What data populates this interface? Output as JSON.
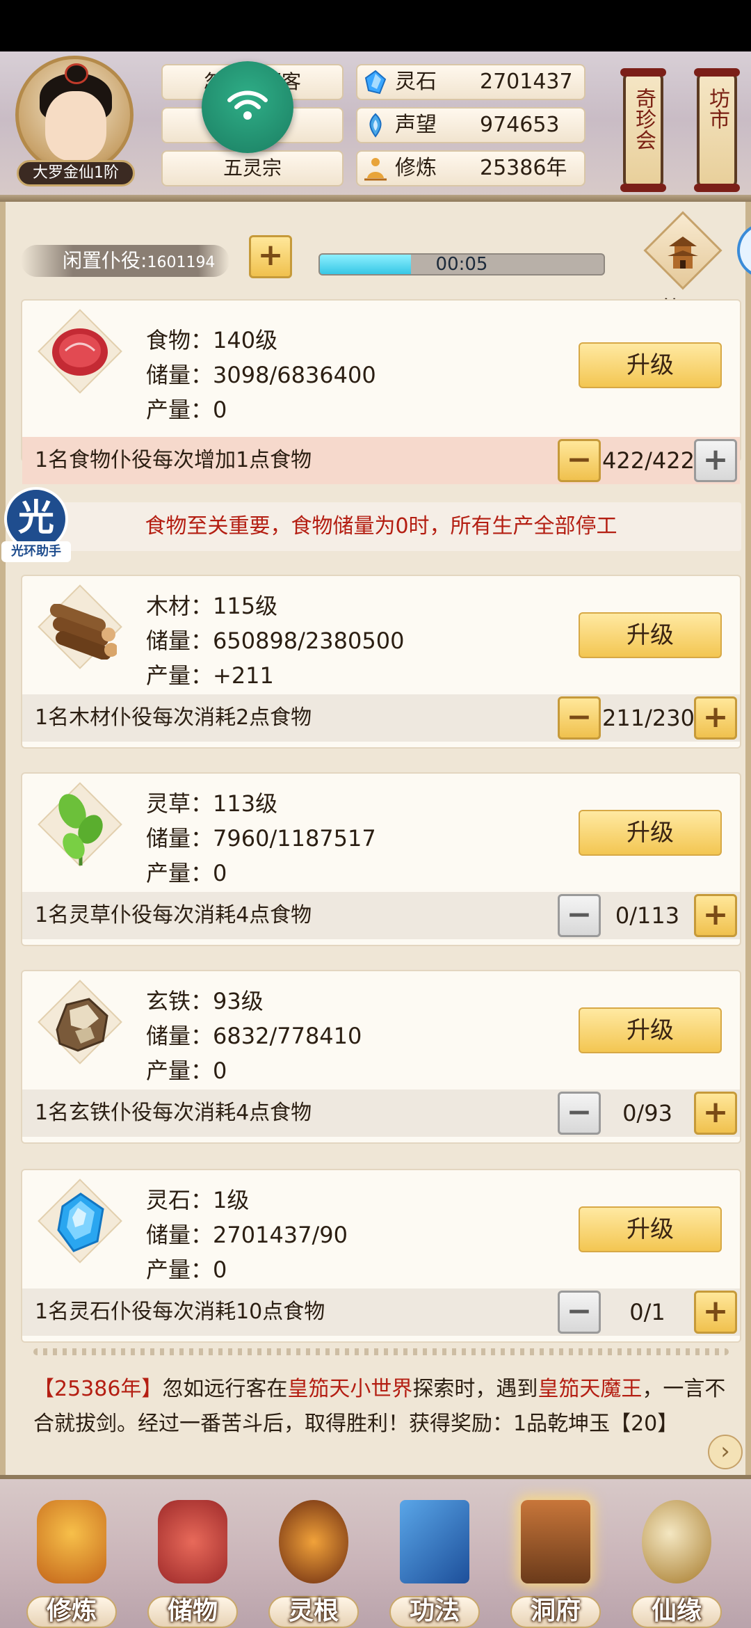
{
  "header": {
    "rank_label": "大罗金仙1阶",
    "name_line1": "忽如远行客",
    "name_line2": "",
    "sect": "五灵宗",
    "resources": [
      {
        "icon": "spirit-stone-icon",
        "label": "灵石",
        "value": "2701437"
      },
      {
        "icon": "reputation-icon",
        "label": "声望",
        "value": "974653"
      },
      {
        "icon": "cultivation-icon",
        "label": "修炼",
        "value": "25386年"
      }
    ],
    "side_buttons": [
      "奇珍会",
      "坊市"
    ]
  },
  "servants": {
    "label": "闲置仆役",
    "count": "1601194",
    "timer": "00:05",
    "timer_progress": 0.32
  },
  "xianju_label": "仙居",
  "cards": [
    {
      "name": "食物：140级",
      "storage": "储量：3098/6836400",
      "output": "产量：0",
      "upgrade": "升级",
      "desc": "1名食物仆役每次增加1点食物",
      "count": "422/422"
    },
    {
      "name": "木材：115级",
      "storage": "储量：650898/2380500",
      "output": "产量：+211",
      "upgrade": "升级",
      "desc": "1名木材仆役每次消耗2点食物",
      "count": "211/230"
    },
    {
      "name": "灵草：113级",
      "storage": "储量：7960/1187517",
      "output": "产量：0",
      "upgrade": "升级",
      "desc": "1名灵草仆役每次消耗4点食物",
      "count": "0/113"
    },
    {
      "name": "玄铁：93级",
      "storage": "储量：6832/778410",
      "output": "产量：0",
      "upgrade": "升级",
      "desc": "1名玄铁仆役每次消耗4点食物",
      "count": "0/93"
    },
    {
      "name": "灵石：1级",
      "storage": "储量：2701437/90",
      "output": "产量：0",
      "upgrade": "升级",
      "desc": "1名灵石仆役每次消耗10点食物",
      "count": "0/1"
    }
  ],
  "warning": "食物至关重要，食物储量为0时，所有生产全部停工",
  "floating_badge": {
    "glyph": "光",
    "label": "光环助手"
  },
  "log": {
    "year": "【25386年】",
    "text1": "忽如远行客在",
    "place": "皇笳天小世界",
    "text2": "探索时，遇到",
    "enemy": "皇笳天魔王",
    "text3": "，一言不合就拔剑。经过一番苦斗后，取得胜利！获得奖励：1品乾坤玉【20】"
  },
  "nav": [
    {
      "label": "修炼"
    },
    {
      "label": "储物"
    },
    {
      "label": "灵根"
    },
    {
      "label": "功法"
    },
    {
      "label": "洞府"
    },
    {
      "label": "仙缘"
    }
  ],
  "colors": {
    "accent_gold": "#f3c652",
    "warning_red": "#b41e12",
    "progress_cyan": "#37c7e5"
  }
}
